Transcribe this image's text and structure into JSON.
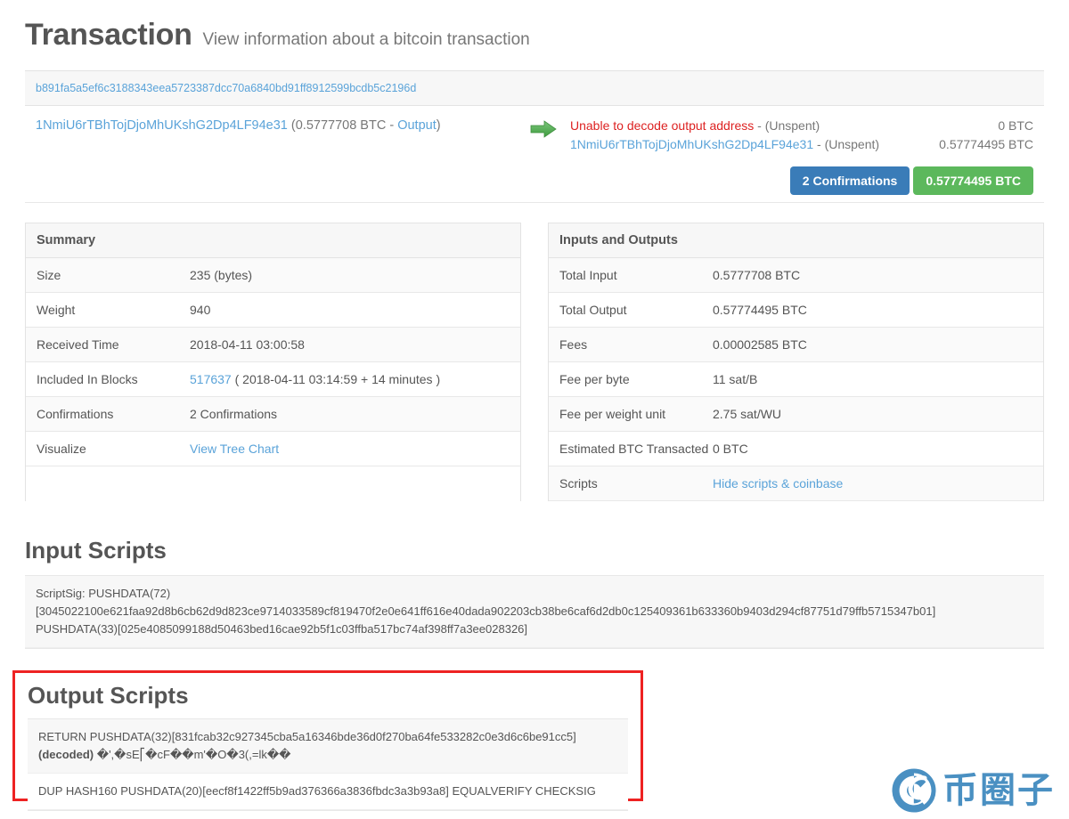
{
  "header": {
    "title": "Transaction",
    "subtitle": "View information about a bitcoin transaction"
  },
  "transaction": {
    "hash": "b891fa5a5ef6c3188343eea5723387dcc70a6840bd91ff8912599bcdb5c2196d",
    "input": {
      "address": "1NmiU6rTBhTojDjoMhUKshG2Dp4LF94e31",
      "detail_open": " (",
      "amount": "0.5777708 BTC",
      "separator": " - ",
      "output_link": "Output",
      "detail_close": ")"
    },
    "arrow_icon": "arrow-right-icon",
    "outputs": [
      {
        "label": "Unable to decode output address",
        "label_is_error": true,
        "status": " - (Unspent)",
        "amount": "0 BTC"
      },
      {
        "label": "1NmiU6rTBhTojDjoMhUKshG2Dp4LF94e31",
        "label_is_error": false,
        "status": " - (Unspent)",
        "amount": "0.57774495 BTC"
      }
    ],
    "badges": {
      "confirmations": "2 Confirmations",
      "amount": "0.57774495 BTC",
      "confirmations_color": "#3a7cb8",
      "amount_color": "#5cb85c"
    }
  },
  "summary": {
    "heading": "Summary",
    "rows": [
      {
        "key": "Size",
        "value": "235 (bytes)"
      },
      {
        "key": "Weight",
        "value": "940"
      },
      {
        "key": "Received Time",
        "value": "2018-04-11 03:00:58"
      },
      {
        "key": "Included In Blocks",
        "link": "517637",
        "value": " ( 2018-04-11 03:14:59 + 14 minutes )"
      },
      {
        "key": "Confirmations",
        "value": "2 Confirmations"
      },
      {
        "key": "Visualize",
        "link": "View Tree Chart",
        "value": ""
      }
    ]
  },
  "inputs_outputs": {
    "heading": "Inputs and Outputs",
    "rows": [
      {
        "key": "Total Input",
        "value": "0.5777708 BTC"
      },
      {
        "key": "Total Output",
        "value": "0.57774495 BTC"
      },
      {
        "key": "Fees",
        "value": "0.00002585 BTC"
      },
      {
        "key": "Fee per byte",
        "value": "11 sat/B"
      },
      {
        "key": "Fee per weight unit",
        "value": "2.75 sat/WU"
      },
      {
        "key": "Estimated BTC Transacted",
        "value": "0 BTC"
      },
      {
        "key": "Scripts",
        "link": "Hide scripts & coinbase",
        "value": ""
      }
    ]
  },
  "input_scripts": {
    "title": "Input Scripts",
    "line1": "ScriptSig: PUSHDATA(72)",
    "line2": "[3045022100e621faa92d8b6cb62d9d823ce9714033589cf819470f2e0e641ff616e40dada902203cb38be6caf6d2db0c125409361b633360b9403d294cf87751d79ffb5715347b01]",
    "line3": "PUSHDATA(33)[025e4085099188d50463bed16cae92b5f1c03ffba517bc74af398ff7a3ee028326]"
  },
  "output_scripts": {
    "title": "Output Scripts",
    "row1_line1": "RETURN PUSHDATA(32)[831fcab32c927345cba5a16346bde36d0f270ba64fe533282c0e3d6c6be91cc5]",
    "row1_decoded_label": "(decoded)",
    "row1_decoded_value": "�',�sE⎡�cF��m'�O�3(,=lk��",
    "row2": "DUP HASH160 PUSHDATA(20)[eecf8f1422ff5b9ad376366a3836fbdc3a3b93a8] EQUALVERIFY CHECKSIG",
    "highlight_color": "#ee2222"
  },
  "watermark": {
    "text": "币圈子",
    "logo_icon": "circle-swirl-logo-icon",
    "color": "#4a90c2"
  }
}
